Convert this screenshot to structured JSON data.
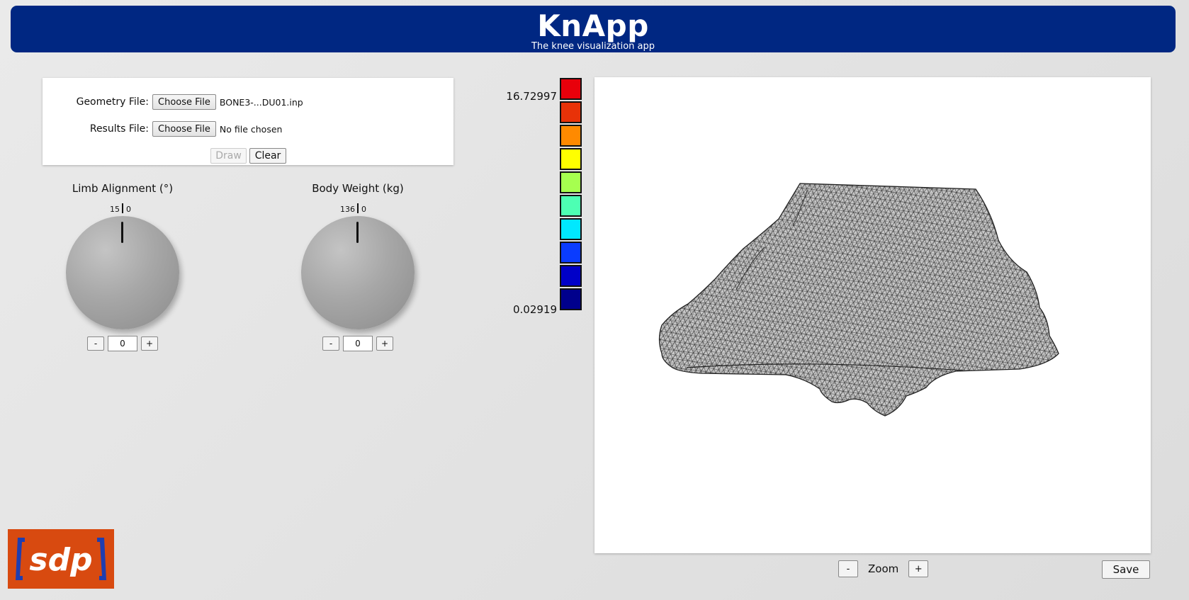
{
  "header": {
    "title": "KnApp",
    "subtitle": "The knee visualization app",
    "background": "#002782"
  },
  "files": {
    "geometry_label": "Geometry File:",
    "geometry_button": "Choose File",
    "geometry_file": "BONE3-...DU01.inp",
    "results_label": "Results File:",
    "results_button": "Choose File",
    "results_file": "No file chosen",
    "draw_label": "Draw",
    "clear_label": "Clear"
  },
  "knobs": {
    "limb": {
      "title": "Limb Alignment (°)",
      "tick_max": "15",
      "tick_min": "0",
      "value": "0",
      "minus": "-",
      "plus": "+"
    },
    "weight": {
      "title": "Body Weight (kg)",
      "tick_max": "136",
      "tick_min": "0",
      "value": "0",
      "minus": "-",
      "plus": "+"
    }
  },
  "legend": {
    "max": "16.72997",
    "min": "0.02919",
    "colors": [
      "#e8000b",
      "#e83208",
      "#ff8a00",
      "#ffff00",
      "#a6ff4f",
      "#4dffb3",
      "#00e8ff",
      "#0a3cff",
      "#0000c8",
      "#00008c"
    ]
  },
  "controls": {
    "zoom_minus": "-",
    "zoom_label": "Zoom",
    "zoom_plus": "+",
    "save": "Save"
  },
  "logo": {
    "text": "[sdp]",
    "color": "#d84a10"
  }
}
